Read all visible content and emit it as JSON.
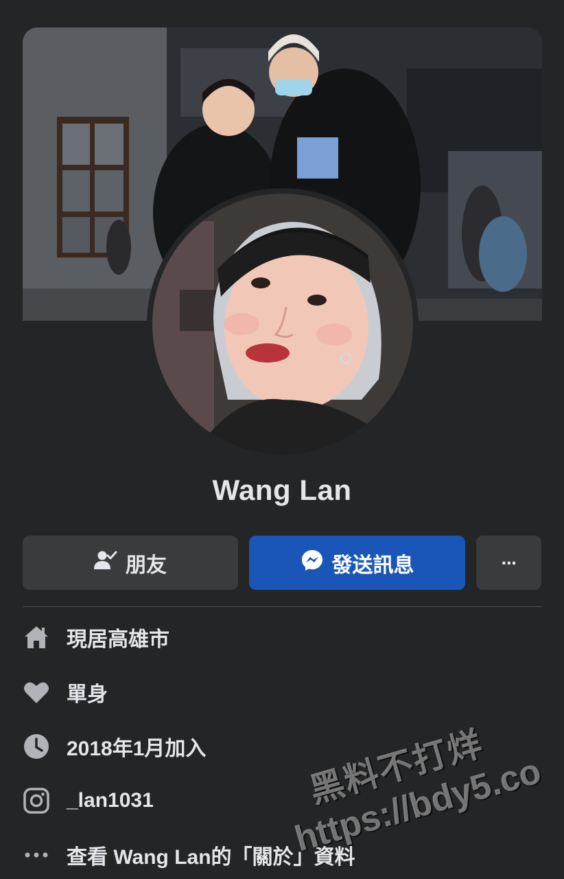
{
  "profile": {
    "name": "Wang Lan"
  },
  "actions": {
    "friends_label": "朋友",
    "message_label": "發送訊息",
    "more_label": "···"
  },
  "info": {
    "residence": "現居高雄市",
    "relationship": "單身",
    "joined": "2018年1月加入",
    "instagram": "_lan1031",
    "about": "查看 Wang Lan的「關於」資料"
  },
  "watermark": {
    "line1": "黑料不打烊",
    "line2": "https://bdy5.co"
  },
  "colors": {
    "background": "#242526",
    "message_button": "#1a56b8",
    "secondary_button": "#3a3b3c"
  }
}
